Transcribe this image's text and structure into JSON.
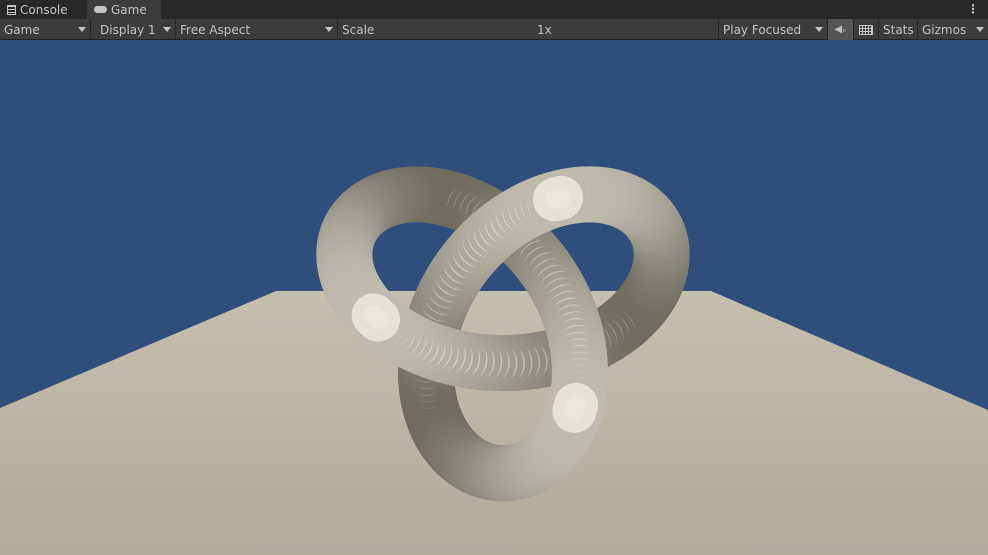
{
  "tabs": [
    {
      "label": "Console",
      "icon": "console-icon"
    },
    {
      "label": "Game",
      "icon": "gamepad-icon",
      "active": true
    }
  ],
  "toolbar": {
    "view_select": "Game",
    "display": "Display 1",
    "aspect": "Free Aspect",
    "scale_label": "Scale",
    "scale_value": "1x",
    "scale_level": 0,
    "play_mode": "Play Focused",
    "mute_icon": "mute-audio-icon",
    "keyboard_icon": "keyboard-icon",
    "stats": "Stats",
    "gizmos": "Gizmos"
  },
  "colors": {
    "sky": "#2f4e7c",
    "floor": "#b2ac9b",
    "knot": "#d8d3c2"
  }
}
